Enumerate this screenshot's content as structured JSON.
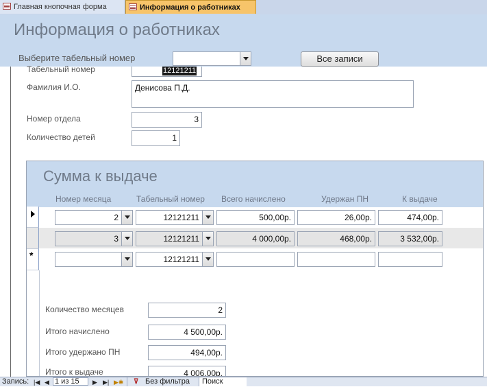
{
  "tabs": [
    {
      "label": "Главная кнопочная форма"
    },
    {
      "label": "Информация о работниках"
    }
  ],
  "form": {
    "title": "Информация о работниках",
    "select_label": "Выберите табельный номер",
    "select_value": "",
    "all_records_button": "Все записи",
    "fields": {
      "tab_number_label": "Табельный номер",
      "tab_number_value": "12121211",
      "fio_label": "Фамилия И.О.",
      "fio_value": "Денисова П.Д.",
      "dept_label": "Номер отдела",
      "dept_value": "3",
      "children_label": "Количество детей",
      "children_value": "1"
    }
  },
  "subform": {
    "title": "Сумма к выдаче",
    "columns": [
      "Номер месяца",
      "Табельный номер",
      "Всего начислено",
      "Удержан ПН",
      "К выдаче"
    ],
    "rows": [
      {
        "month": "2",
        "tab": "12121211",
        "total": "500,00р.",
        "tax": "26,00р.",
        "pay": "474,00р."
      },
      {
        "month": "3",
        "tab": "12121211",
        "total": "4 000,00р.",
        "tax": "468,00р.",
        "pay": "3 532,00р."
      },
      {
        "month": "",
        "tab": "12121211",
        "total": "",
        "tax": "",
        "pay": ""
      }
    ],
    "summary": {
      "months_label": "Количество месяцев",
      "months_value": "2",
      "accrued_label": "Итого начислено",
      "accrued_value": "4 500,00р.",
      "withheld_label": "Итого удержано ПН",
      "withheld_value": "494,00р.",
      "payout_label": "Итого к выдаче",
      "payout_value": "4 006,00р."
    }
  },
  "statusbar": {
    "records_label": "Запись:",
    "record_position": "1 из 15",
    "filter_label": "Без фильтра",
    "search_label": "Поиск"
  }
}
